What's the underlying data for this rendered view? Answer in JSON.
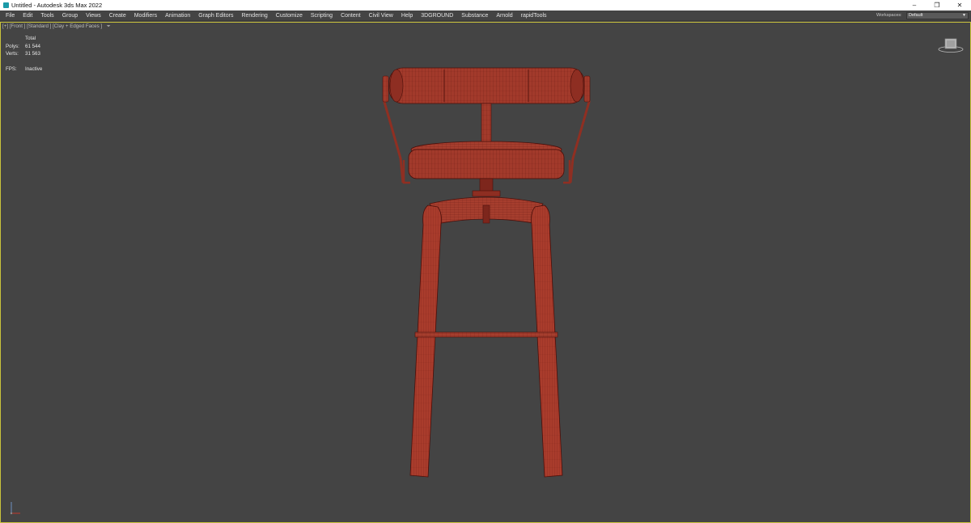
{
  "window": {
    "title": "Untitled - Autodesk 3ds Max 2022",
    "controls": {
      "minimize": "–",
      "maximize": "❐",
      "close": "✕"
    }
  },
  "menu": {
    "items": [
      "File",
      "Edit",
      "Tools",
      "Group",
      "Views",
      "Create",
      "Modifiers",
      "Animation",
      "Graph Editors",
      "Rendering",
      "Customize",
      "Scripting",
      "Content",
      "Civil View",
      "Help",
      "3DGROUND",
      "Substance",
      "Arnold",
      "rapidTools"
    ],
    "workspaces_label": "Workspaces:",
    "workspace_value": "Default"
  },
  "viewport": {
    "label": "[+] [Front ] [Standard ] [Clay + Edged Faces ]",
    "stats": {
      "header": "Total",
      "polys_label": "Polys:",
      "polys_value": "61 544",
      "verts_label": "Verts:",
      "verts_value": "31 563",
      "fps_label": "FPS:",
      "fps_value": "Inactive"
    }
  },
  "colors": {
    "viewport_bg": "#444444",
    "model_fill": "#a23a2b",
    "wire": "#5a120c",
    "active_border": "#c9c23c"
  }
}
